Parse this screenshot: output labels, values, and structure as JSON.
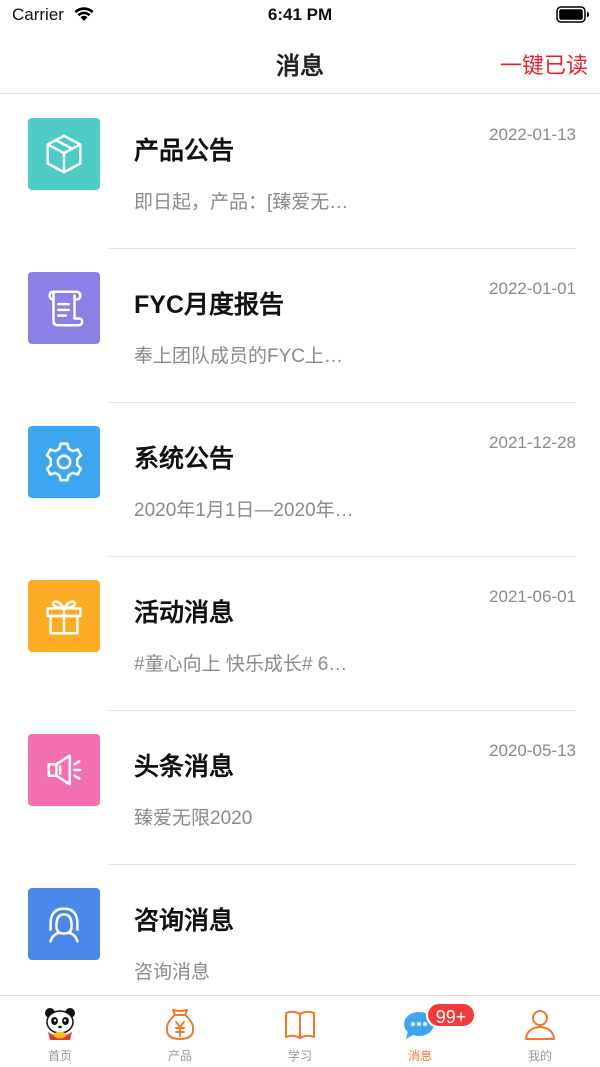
{
  "status_bar": {
    "carrier": "Carrier",
    "time": "6:41 PM"
  },
  "nav": {
    "title": "消息",
    "action_label": "一键已读"
  },
  "messages": [
    {
      "title": "产品公告",
      "date": "2022-01-13",
      "snippet": "即日起，产品：[臻爱无…",
      "icon": "box-icon",
      "color": "#4ecbc4"
    },
    {
      "title": "FYC月度报告",
      "date": "2022-01-01",
      "snippet": "奉上团队成员的FYC上…",
      "icon": "scroll-icon",
      "color": "#8a80e6"
    },
    {
      "title": "系统公告",
      "date": "2021-12-28",
      "snippet": "2020年1月1日—2020年…",
      "icon": "gear-icon",
      "color": "#3ea6f0"
    },
    {
      "title": "活动消息",
      "date": "2021-06-01",
      "snippet": "#童心向上 快乐成长# 6…",
      "icon": "gift-icon",
      "color": "#fbab24"
    },
    {
      "title": "头条消息",
      "date": "2020-05-13",
      "snippet": "臻爱无限2020",
      "icon": "megaphone-icon",
      "color": "#f46fb0"
    },
    {
      "title": "咨询消息",
      "date": "",
      "snippet": "咨询消息",
      "icon": "headset-icon",
      "color": "#4a88ea"
    }
  ],
  "tab_bar": {
    "items": [
      {
        "label": "首页",
        "icon": "panda-icon",
        "active": false
      },
      {
        "label": "产品",
        "icon": "money-bag-icon",
        "active": false
      },
      {
        "label": "学习",
        "icon": "book-icon",
        "active": false
      },
      {
        "label": "消息",
        "icon": "chat-icon",
        "active": true,
        "badge": "99+"
      },
      {
        "label": "我的",
        "icon": "user-icon",
        "active": false
      }
    ]
  },
  "colors": {
    "accent": "#f5762a",
    "action": "#e8222d",
    "badge": "#f23a3a"
  }
}
